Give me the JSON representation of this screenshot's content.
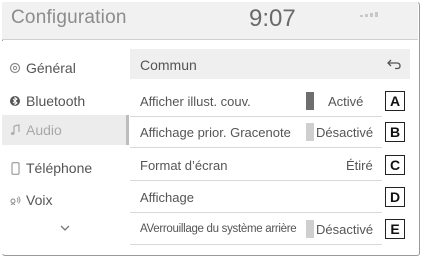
{
  "header": {
    "title": "Configuration",
    "clock": "9:07",
    "status_icon": "signal-icon"
  },
  "sidebar": {
    "items": [
      {
        "label": "Général",
        "icon": "gear-icon"
      },
      {
        "label": "Bluetooth",
        "icon": "bluetooth-icon"
      },
      {
        "label": "Audio",
        "icon": "music-note-icon",
        "active": true
      },
      {
        "label": "Téléphone",
        "icon": "phone-icon"
      },
      {
        "label": "Voix",
        "icon": "voice-icon"
      }
    ],
    "more_icon": "chevron-down-icon"
  },
  "main": {
    "section_title": "Commun",
    "back_icon": "back-arrow-icon",
    "rows": [
      {
        "label": "Afficher illust. couv.",
        "value": "Activé",
        "toggle": "on",
        "marker": "A"
      },
      {
        "label": "Affichage prior. Gracenote",
        "value": "Désactivé",
        "toggle": "off",
        "marker": "B"
      },
      {
        "label": "Format d’écran",
        "value": "Étiré",
        "marker": "C"
      },
      {
        "label": "Affichage",
        "value": "",
        "marker": "D"
      },
      {
        "label": "AVerrouillage du système arrière",
        "value": "Désactivé",
        "toggle": "off",
        "marker": "E"
      }
    ]
  },
  "colors": {
    "header_bg": "#f1f1f1",
    "active_bg": "#ececec",
    "toggle_on": "#6e6e6e",
    "toggle_off": "#cfcfcf"
  }
}
